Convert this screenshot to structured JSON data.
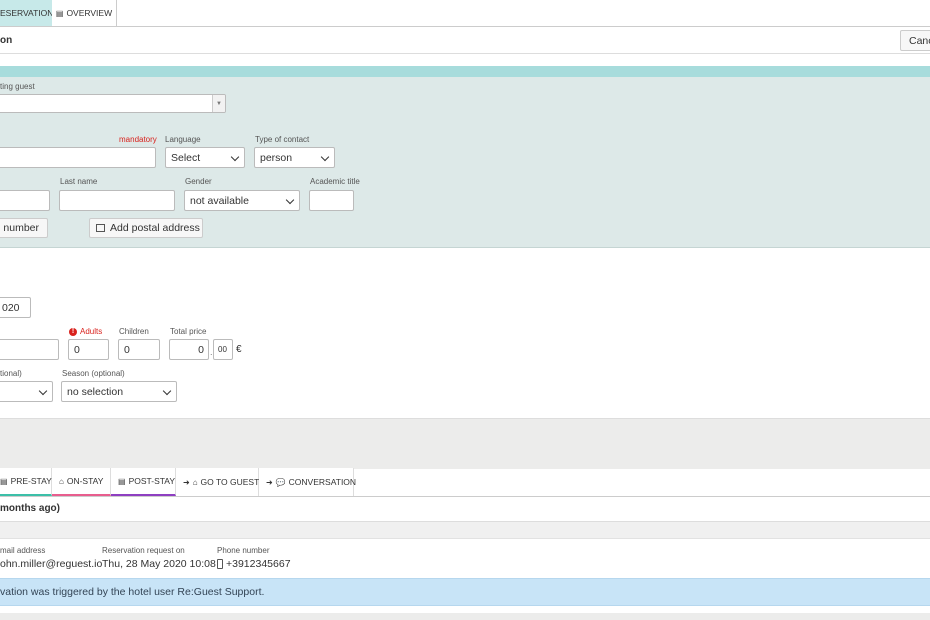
{
  "tabs": {
    "reservation": "ESERVATION",
    "overview": "OVERVIEW"
  },
  "header": {
    "title": "on",
    "cancel": "Canc"
  },
  "guest_form": {
    "existing_guest_label": "ting guest",
    "mandatory": "mandatory",
    "language_label": "Language",
    "language_value": "Select",
    "contact_type_label": "Type of contact",
    "contact_type_value": "person",
    "last_name_label": "Last name",
    "gender_label": "Gender",
    "gender_value": "not available",
    "academic_title_label": "Academic title",
    "phone_btn": "e number",
    "postal_btn": "Add postal address"
  },
  "stay_form": {
    "date_value": "020",
    "adults_label": "Adults",
    "adults_value": "0",
    "children_label": "Children",
    "children_value": "0",
    "total_price_label": "Total price",
    "price_value": "0",
    "cents_value": "00",
    "currency": "€",
    "optional_label": "tional)",
    "season_label": "Season (optional)",
    "season_value": "no selection"
  },
  "bottom_tabs": {
    "pre_stay": "PRE-STAY",
    "on_stay": "ON-STAY",
    "post_stay": "POST-STAY",
    "go_to_guest": "GO TO GUEST",
    "conversation": "CONVERSATION"
  },
  "detail": {
    "since": "months ago)",
    "email_label": "mail address",
    "email_value": "ohn.miller@reguest.io",
    "request_label": "Reservation request on",
    "request_value": "Thu, 28 May 2020 10:08",
    "phone_label": "Phone number",
    "phone_value": "+3912345667",
    "info_text": "vation was triggered by the hotel user Re:Guest Support."
  },
  "colors": {
    "teal": "#a7dcdc",
    "panel": "#dde9e8",
    "grey": "#ececeb",
    "info": "#c8e4f7",
    "mandatory": "#d9221d"
  }
}
